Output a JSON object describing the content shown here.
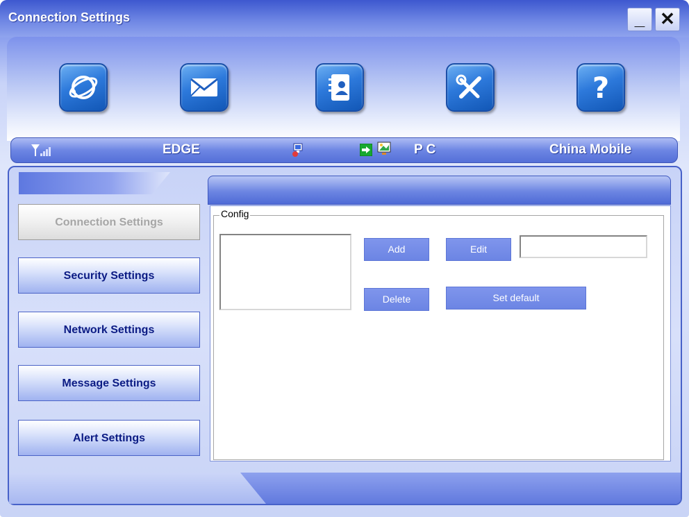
{
  "window": {
    "title": "Connection Settings",
    "minimize_label": "_",
    "close_label": "✕"
  },
  "toolbar": {
    "icons": [
      "internet-icon",
      "mail-icon",
      "contacts-icon",
      "tools-icon",
      "help-icon"
    ]
  },
  "status": {
    "network_type": "EDGE",
    "connection_target": "P C",
    "operator": "China Mobile"
  },
  "sidebar": {
    "items": [
      {
        "label": "Connection Settings",
        "active": true
      },
      {
        "label": "Security Settings",
        "active": false
      },
      {
        "label": "Network Settings",
        "active": false
      },
      {
        "label": "Message Settings",
        "active": false
      },
      {
        "label": "Alert Settings",
        "active": false
      }
    ]
  },
  "config": {
    "group_label": "Config",
    "add_label": "Add",
    "edit_label": "Edit",
    "delete_label": "Delete",
    "set_default_label": "Set default",
    "name_value": ""
  },
  "colors": {
    "accent": "#5a74dc",
    "nav_text": "#0b1b84",
    "active_text": "#a6a6a6"
  }
}
